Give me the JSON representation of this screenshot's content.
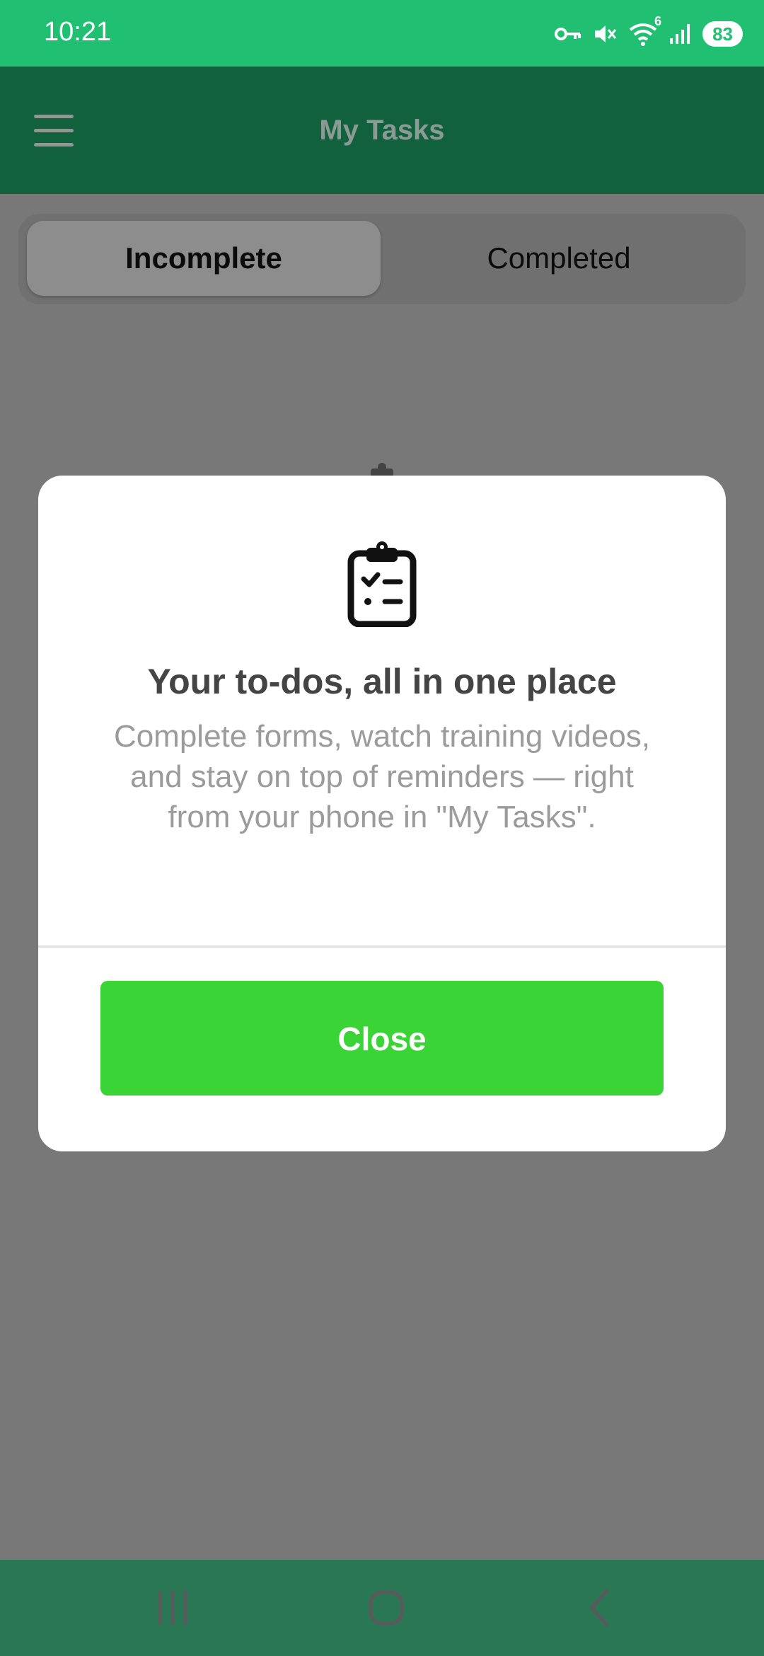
{
  "status_bar": {
    "time": "10:21",
    "battery": "83",
    "wifi_badge": "6",
    "icons": [
      "key-icon",
      "mute-icon",
      "wifi-icon",
      "signal-icon",
      "battery-icon"
    ]
  },
  "header": {
    "title": "My Tasks",
    "menu_icon": "hamburger-menu-icon"
  },
  "tabs": [
    {
      "label": "Incomplete",
      "selected": true
    },
    {
      "label": "Completed",
      "selected": false
    }
  ],
  "modal": {
    "icon": "clipboard-checklist-icon",
    "title": "Your to-dos, all in one place",
    "description": "Complete forms, watch training videos, and stay on top of reminders — right from your phone in \"My Tasks\".",
    "close_label": "Close"
  },
  "nav_bar": {
    "items": [
      "recents-icon",
      "home-icon",
      "back-icon"
    ]
  },
  "colors": {
    "status_bar": "#20bf72",
    "header": "#11603e",
    "overlay": "#787878",
    "close_button": "#3bd436",
    "nav_bar": "#2a7756"
  }
}
